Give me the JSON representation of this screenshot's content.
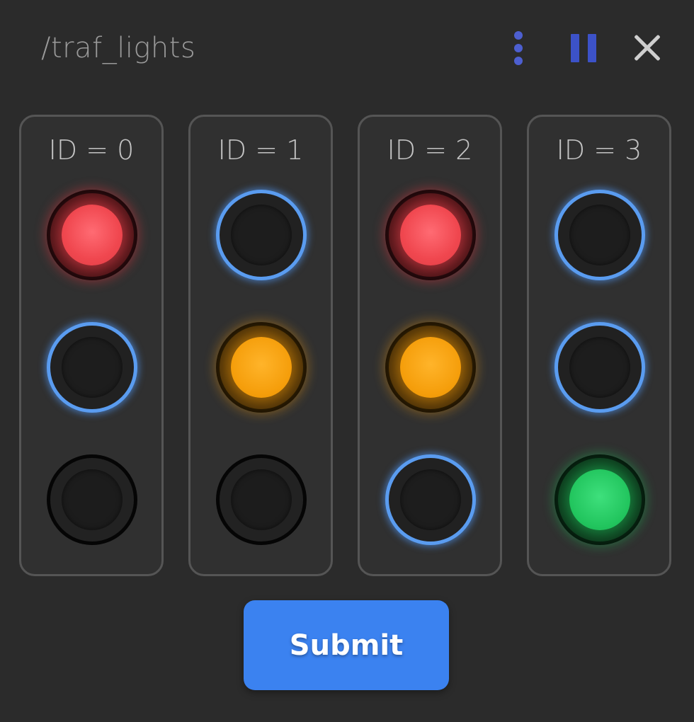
{
  "header": {
    "title": "/traf_lights",
    "actions": [
      {
        "icon": "kebab-menu-icon",
        "color": "#4d5fd0"
      },
      {
        "icon": "pause-icon",
        "color": "#3c52c8"
      },
      {
        "icon": "close-icon",
        "color": "#cfcfcf"
      }
    ]
  },
  "lights": [
    {
      "label": "ID = 0",
      "lamps": [
        {
          "color": "red",
          "state": "on"
        },
        {
          "color": "amber",
          "state": "off",
          "highlighted": true
        },
        {
          "color": "green",
          "state": "off",
          "highlighted": false
        }
      ]
    },
    {
      "label": "ID = 1",
      "lamps": [
        {
          "color": "red",
          "state": "off",
          "highlighted": true
        },
        {
          "color": "amber",
          "state": "on"
        },
        {
          "color": "green",
          "state": "off",
          "highlighted": false
        }
      ]
    },
    {
      "label": "ID = 2",
      "lamps": [
        {
          "color": "red",
          "state": "on"
        },
        {
          "color": "amber",
          "state": "on"
        },
        {
          "color": "green",
          "state": "off",
          "highlighted": true
        }
      ]
    },
    {
      "label": "ID = 3",
      "lamps": [
        {
          "color": "red",
          "state": "off",
          "highlighted": true
        },
        {
          "color": "amber",
          "state": "off",
          "highlighted": true
        },
        {
          "color": "green",
          "state": "on"
        }
      ]
    }
  ],
  "colors": {
    "background": "#2b2b2b",
    "panel_border": "#555555",
    "red": "#f0474f",
    "amber": "#f59e0b",
    "green": "#22c55e",
    "highlight_ring": "#5a9cf0",
    "accent": "#3b82f0"
  },
  "submit_label": "Submit"
}
